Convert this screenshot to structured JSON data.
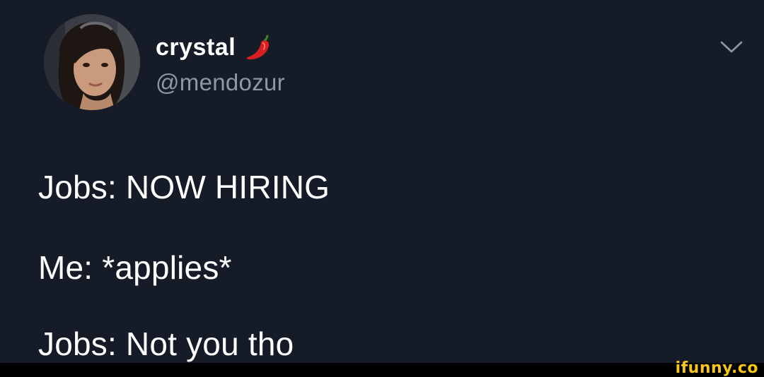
{
  "tweet": {
    "author": {
      "display_name": "crystal",
      "name_emoji": "pepper-icon",
      "handle": "@mendozur"
    },
    "menu_icon": "chevron-down-icon",
    "lines": [
      "Jobs: NOW HIRING",
      "Me: *applies*",
      "Jobs: Not you tho"
    ]
  },
  "watermark": {
    "text": "ifunny.co",
    "color": "#f5c518"
  },
  "colors": {
    "background": "#151c28",
    "text": "#ffffff",
    "secondary_text": "#8b98a5",
    "pepper": "#d91f1f",
    "pepper_stem": "#3a8a2a"
  }
}
